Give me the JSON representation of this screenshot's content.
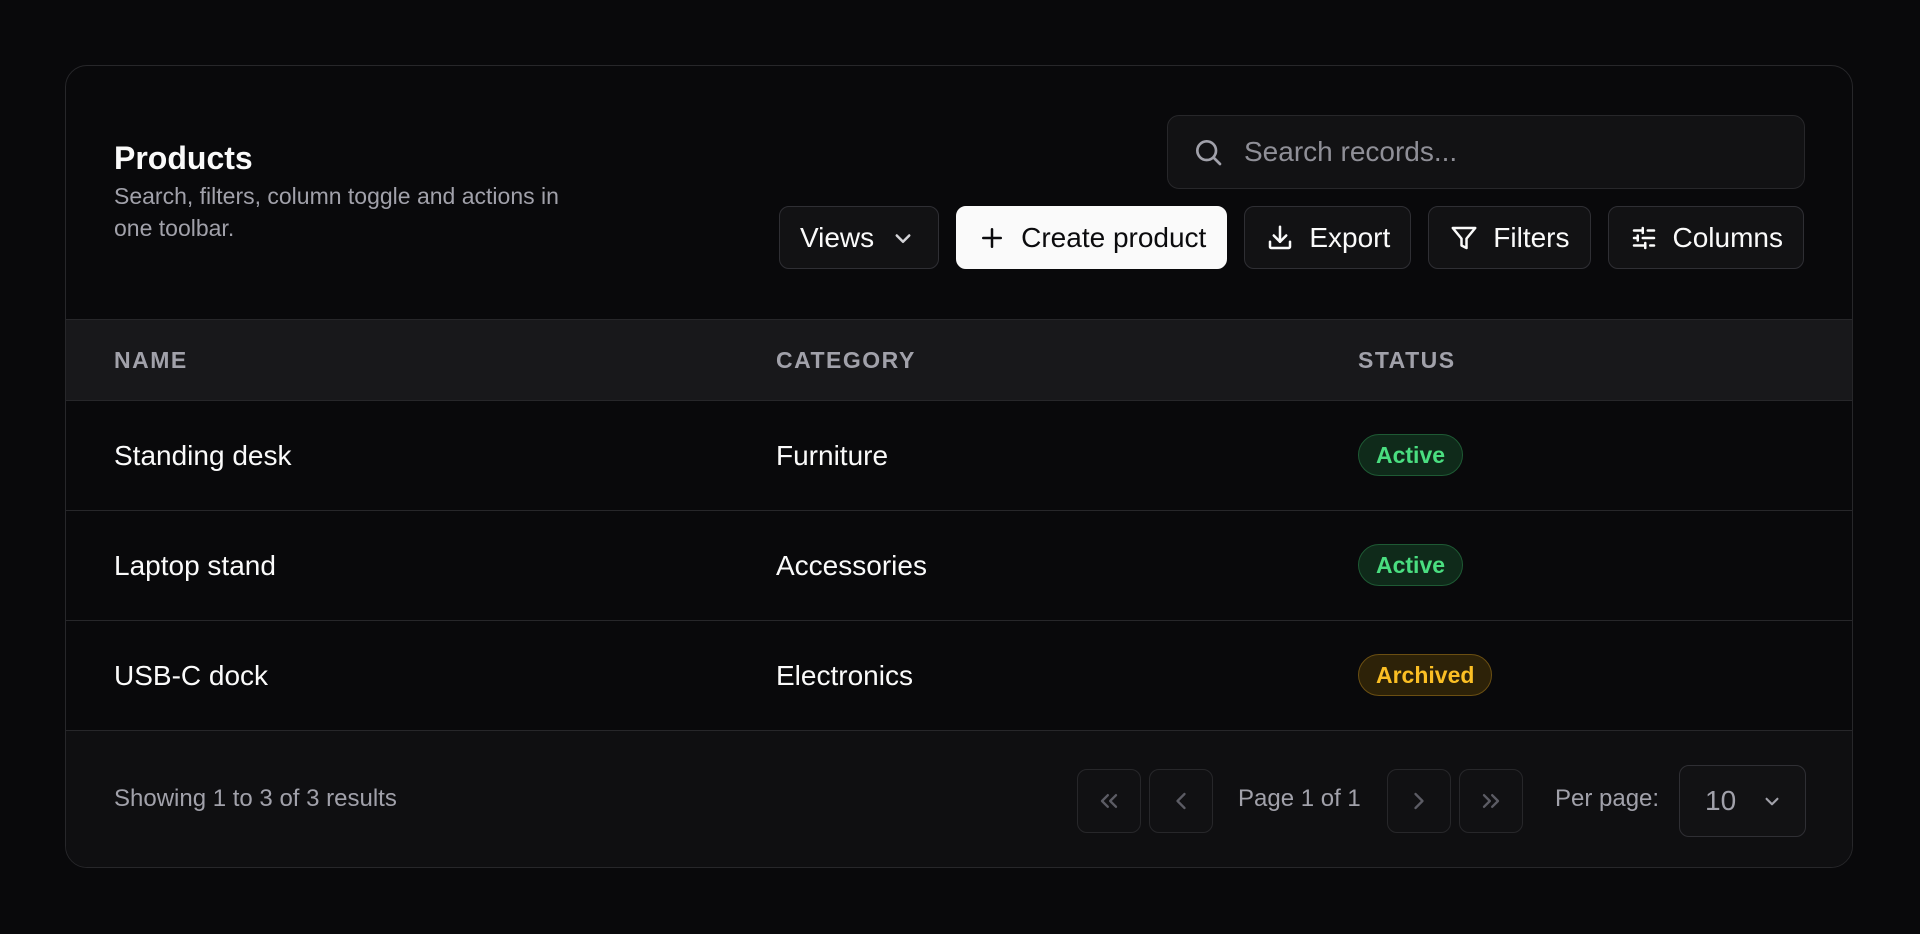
{
  "header": {
    "title": "Products",
    "subtitle": "Search, filters, column toggle and actions in one toolbar."
  },
  "search": {
    "placeholder": "Search records...",
    "value": "",
    "icon": "search-icon"
  },
  "toolbar": {
    "views_label": "Views",
    "create_label": "Create product",
    "export_label": "Export",
    "filters_label": "Filters",
    "columns_label": "Columns"
  },
  "table": {
    "columns": [
      "NAME",
      "CATEGORY",
      "STATUS"
    ],
    "rows": [
      {
        "name": "Standing desk",
        "category": "Furniture",
        "status": "Active"
      },
      {
        "name": "Laptop stand",
        "category": "Accessories",
        "status": "Active"
      },
      {
        "name": "USB-C dock",
        "category": "Electronics",
        "status": "Archived"
      }
    ]
  },
  "footer": {
    "results": "Showing 1 to 3 of 3 results",
    "page": "Page 1 of 1",
    "per_page_label": "Per page:",
    "per_page_value": "10"
  },
  "colors": {
    "background": "#09090b",
    "active": "#4ade80",
    "archived": "#fbbf24",
    "primary_button": "#fafafa"
  }
}
